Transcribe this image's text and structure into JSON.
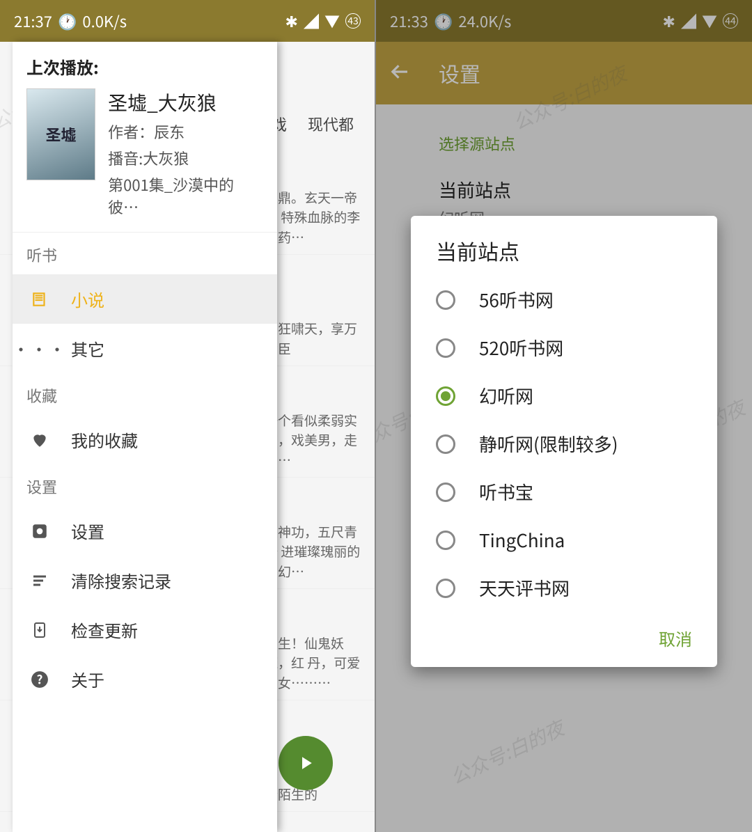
{
  "left": {
    "status": {
      "time": "21:37",
      "net": "0.0K/s",
      "batt": "43"
    },
    "bg": {
      "tabs": [
        "游戏",
        "现代都"
      ],
      "lines": [
        "天鼎。玄天一帝掌\n特殊血脉的李家药…",
        "刀狂啸天，享万世臣",
        "一个看似柔弱实\n物，戏美男，走向…",
        "上神功，五尺青锋\n进璀璨瑰丽的玄幻…",
        "人生！仙鬼妖魔，红\n丹，可爱仙女………",
        "个陌生的"
      ]
    },
    "drawer": {
      "last_play_label": "上次播放:",
      "book": {
        "cover_text": "圣墟",
        "title": "圣墟_大灰狼",
        "author": "作者：辰东",
        "narrator": "播音:大灰狼",
        "episode": "第001集_沙漠中的彼…"
      },
      "sections": {
        "listen": {
          "header": "听书",
          "items": [
            {
              "label": "小说",
              "icon": "book-icon",
              "active": true
            },
            {
              "label": "其它",
              "icon": "dots-icon"
            }
          ]
        },
        "favorite": {
          "header": "收藏",
          "items": [
            {
              "label": "我的收藏",
              "icon": "heart-icon"
            }
          ]
        },
        "settings": {
          "header": "设置",
          "items": [
            {
              "label": "设置",
              "icon": "gear-icon"
            },
            {
              "label": "清除搜索记录",
              "icon": "clear-icon"
            },
            {
              "label": "检查更新",
              "icon": "update-icon"
            },
            {
              "label": "关于",
              "icon": "help-icon"
            }
          ]
        }
      }
    }
  },
  "right": {
    "status": {
      "time": "21:33",
      "net": "24.0K/s",
      "batt": "44"
    },
    "appbar": {
      "title": "设置"
    },
    "content": {
      "select_source": "选择源站点",
      "current_site_label": "当前站点",
      "current_site_value": "幻听网"
    },
    "dialog": {
      "title": "当前站点",
      "options": [
        {
          "label": "56听书网",
          "selected": false
        },
        {
          "label": "520听书网",
          "selected": false
        },
        {
          "label": "幻听网",
          "selected": true
        },
        {
          "label": "静听网(限制较多)",
          "selected": false
        },
        {
          "label": "听书宝",
          "selected": false
        },
        {
          "label": "TingChina",
          "selected": false
        },
        {
          "label": "天天评书网",
          "selected": false
        }
      ],
      "cancel": "取消"
    }
  },
  "watermark": "公众号:白的夜"
}
